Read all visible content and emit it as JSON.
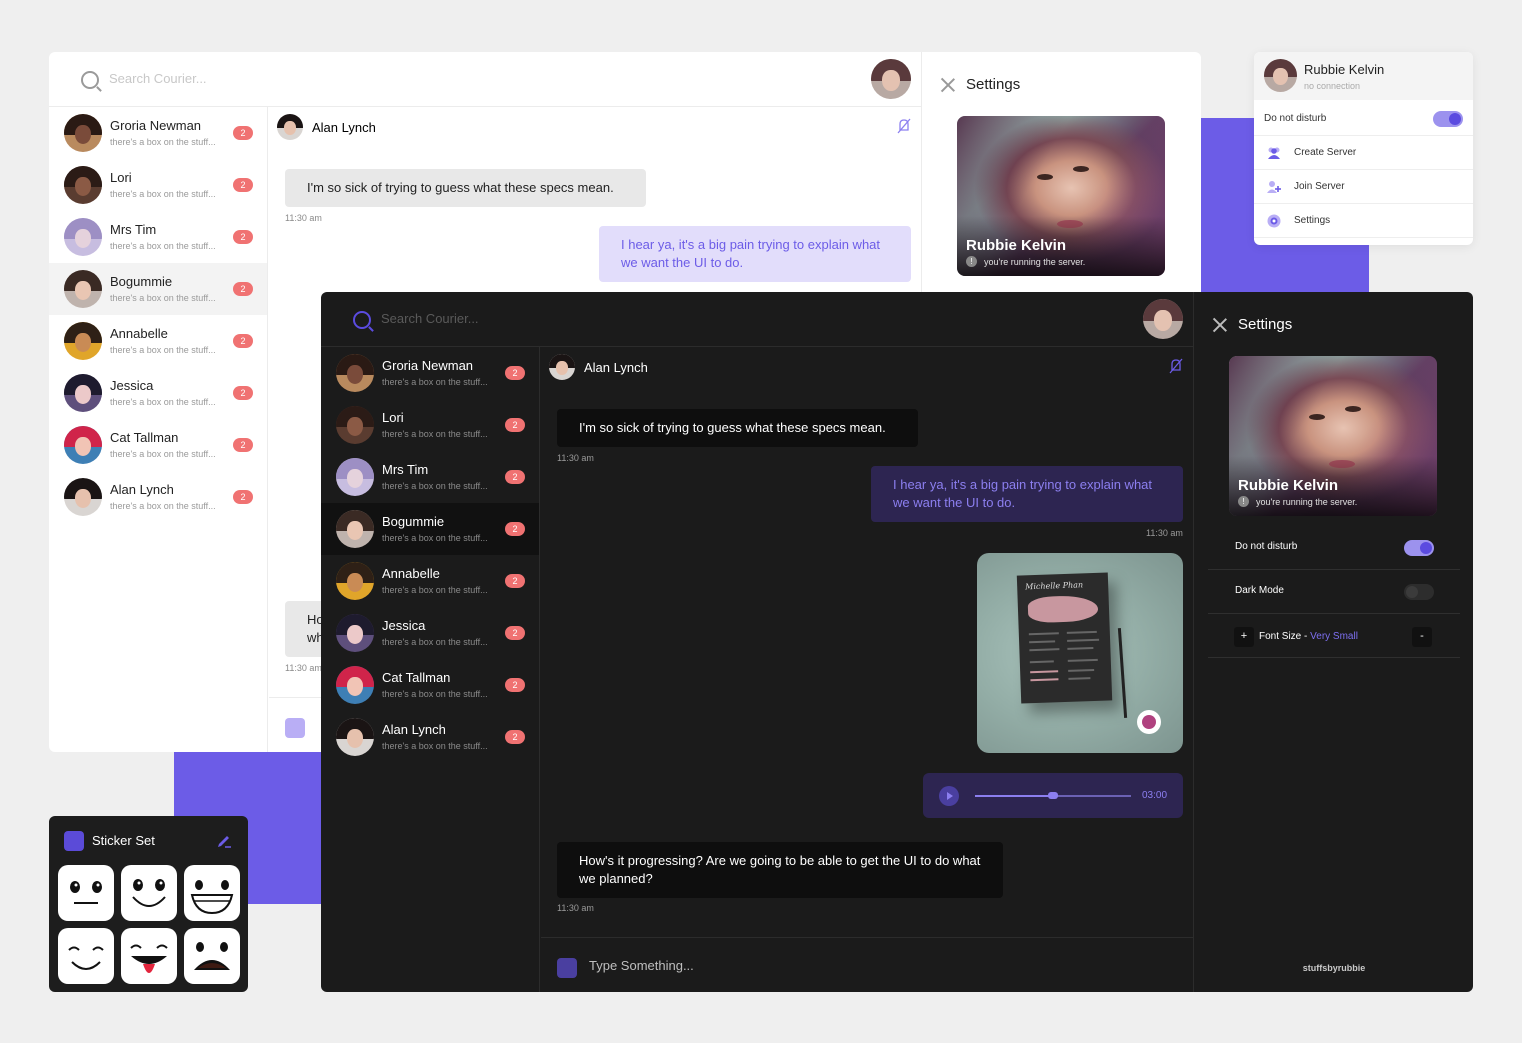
{
  "colors": {
    "accent": "#6c5ce7",
    "badge": "#f07272",
    "dark_bg": "#1b1b1b",
    "light_bg": "#ffffff",
    "page_bg": "#efefef"
  },
  "search": {
    "placeholder": "Search Courier..."
  },
  "contacts": [
    {
      "name": "Groria Newman",
      "preview": "there's a box on the stuff...",
      "unread": "2",
      "avatar": {
        "skin": "#7a4b3a",
        "hair": "#2a1a14",
        "bg": "#b98a5e"
      }
    },
    {
      "name": "Lori",
      "preview": "there's a box on the stuff...",
      "unread": "2",
      "avatar": {
        "skin": "#8b5a45",
        "hair": "#2b1b16",
        "bg": "#5a3c30"
      }
    },
    {
      "name": "Mrs Tim",
      "preview": "there's a box on the stuff...",
      "unread": "2",
      "avatar": {
        "skin": "#e5d2dc",
        "hair": "#9d8fc4",
        "bg": "#c7bde0"
      }
    },
    {
      "name": "Bogummie",
      "preview": "there's a box on the stuff...",
      "unread": "2",
      "avatar": {
        "skin": "#e9c6b3",
        "hair": "#3a2a24",
        "bg": "#bfb3ad"
      }
    },
    {
      "name": "Annabelle",
      "preview": "there's a box on the stuff...",
      "unread": "2",
      "avatar": {
        "skin": "#c98b55",
        "hair": "#2e2016",
        "bg": "#e0a52a"
      }
    },
    {
      "name": "Jessica",
      "preview": "there's a box on the stuff...",
      "unread": "2",
      "avatar": {
        "skin": "#ecc9c9",
        "hair": "#1e1b2e",
        "bg": "#5e4f7c"
      }
    },
    {
      "name": "Cat Tallman",
      "preview": "there's a box on the stuff...",
      "unread": "2",
      "avatar": {
        "skin": "#f1c4b5",
        "hair": "#d0244a",
        "bg": "#3e7fb5"
      }
    },
    {
      "name": "Alan Lynch",
      "preview": "there's a box on the stuff...",
      "unread": "2",
      "avatar": {
        "skin": "#e6c1ad",
        "hair": "#1a1414",
        "bg": "#d9d5d2"
      }
    }
  ],
  "chat": {
    "contact_name": "Alan Lynch",
    "messages": {
      "m1_text": "I'm so sick of trying to guess what these specs mean.",
      "m1_time": "11:30 am",
      "m2_text": "I hear ya, it's a big pain trying to explain what we want the UI to do.",
      "m2_time": "11:30 am",
      "m3_text": "How's it progressing? Are we going to be able to get the UI to do what we planned?",
      "m3_time": "11:30 am"
    },
    "image_caption": "Michelle Phan",
    "audio": {
      "duration": "03:00",
      "progress": 0.5
    },
    "composer_placeholder": "Type Something..."
  },
  "light_chat_fragments": {
    "partial_text_1": "Ho",
    "partial_text_2": "wh",
    "partial_time": "11:30 am"
  },
  "settings": {
    "title": "Settings",
    "profile_name": "Rubbie Kelvin",
    "profile_status": "you're running the server.",
    "info_icon_glyph": "!",
    "dnd_label": "Do not disturb",
    "dnd_on": true,
    "dark_mode_label": "Dark Mode",
    "dark_mode_on": false,
    "font_size_label": "Font Size - ",
    "font_size_value": "Very Small",
    "plus": "+",
    "minus": "-",
    "footer": "stuffsbyrubbie"
  },
  "menu": {
    "name": "Rubbie Kelvin",
    "status": "no connection",
    "dnd_label": "Do not disturb",
    "items": [
      {
        "label": "Create Server",
        "icon": "users-icon"
      },
      {
        "label": "Join Server",
        "icon": "add-user-icon"
      },
      {
        "label": "Settings",
        "icon": "gear-icon"
      }
    ]
  },
  "stickers": {
    "title": "Sticker Set",
    "items": [
      "neutral",
      "smile",
      "grin",
      "happy-closed-eyes",
      "tongue-out",
      "shocked"
    ]
  }
}
